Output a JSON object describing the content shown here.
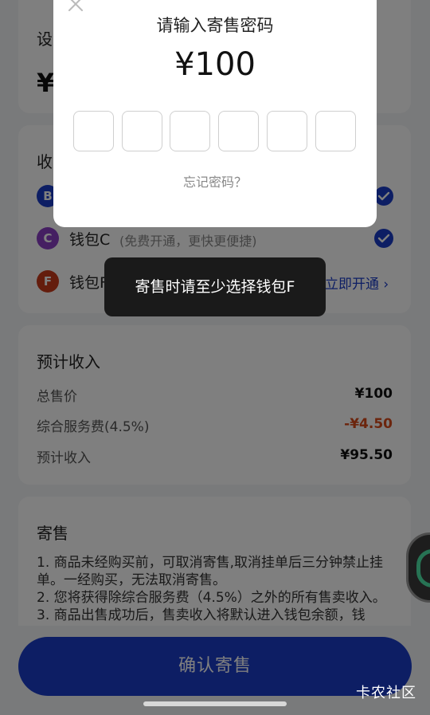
{
  "background": {
    "settings_label": "设",
    "settings_price_yen": "¥",
    "receive_label": "收",
    "wallets": [
      {
        "letter": "B",
        "name": "",
        "sub": "",
        "color": "#1a3cc8",
        "checked": true
      },
      {
        "letter": "C",
        "name": "钱包C",
        "sub": "(免费开通，更快更便捷)",
        "color": "#8a3fc4",
        "checked": true
      },
      {
        "letter": "F",
        "name": "钱包F",
        "sub": "",
        "color": "#c83a1a",
        "checked": false,
        "action": "立即开通"
      }
    ],
    "income": {
      "title": "预计收入",
      "rows": [
        {
          "label": "总售价",
          "value": "¥100"
        },
        {
          "label": "综合服务费(4.5%)",
          "value": "-¥4.50"
        },
        {
          "label": "预计收入",
          "value": "¥95.50"
        }
      ]
    },
    "sale": {
      "title": "寄售",
      "notes": "1. 商品未经购买前，可取消寄售,取消挂单后三分钟禁止挂单。一经购买，无法取消寄售。\n2. 您将获得除综合服务费（4.5%）之外的所有售卖收入。\n3. 商品出售成功后，售卖收入将默认进入钱包余额，钱"
    },
    "confirm_button": "确认寄售"
  },
  "modal": {
    "title": "请输入寄售密码",
    "amount": "¥100",
    "pin_length": 6,
    "forgot_link": "忘记密码？"
  },
  "toast": {
    "message": "寄售时请至少选择钱包F"
  },
  "watermark": "卡农社区",
  "colors": {
    "accent": "#1a3cc8",
    "negative": "#d84a1b"
  }
}
